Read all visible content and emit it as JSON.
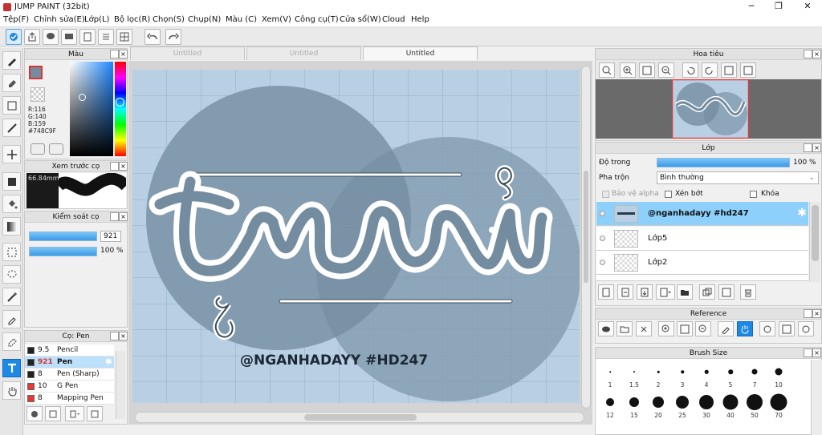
{
  "app": {
    "title": "JUMP PAINT (32bit)"
  },
  "window_controls": {
    "minimize": "─",
    "restore": "❐",
    "close": "✕"
  },
  "menu": [
    "Tệp(F)",
    "Chỉnh sửa(E)",
    "Lớp(L)",
    "Bộ lọc(R)",
    "Chọn(S)",
    "Chụp(N)",
    "Màu (C)",
    "Xem(V)",
    "Công cụ(T)",
    "Cửa sổ(W)",
    "Cloud",
    "Help"
  ],
  "tabs": [
    "Untitled",
    "Untitled",
    "Untitled"
  ],
  "color_panel": {
    "title": "Màu",
    "rgb": [
      "R:116",
      "G:140",
      "B:159"
    ],
    "hex": "#748C9F",
    "current_color": "#748C9F"
  },
  "brush_preview": {
    "title": "Xem trước cọ",
    "size": "66.84mm"
  },
  "brush_control": {
    "title": "Kiểm soát cọ",
    "size_value": "921",
    "opacity_value": "100 %"
  },
  "pen_panel": {
    "title": "Cọ: Pen",
    "items": [
      {
        "size": "9.5",
        "name": "Pencil",
        "color": "#222222"
      },
      {
        "size": "921",
        "name": "Pen",
        "color": "#222222"
      },
      {
        "size": "8",
        "name": "Pen (Sharp)",
        "color": "#222222"
      },
      {
        "size": "10",
        "name": "G Pen",
        "color": "#e53935"
      },
      {
        "size": "8",
        "name": "Mapping Pen",
        "color": "#e53935"
      }
    ]
  },
  "canvas": {
    "main_text": "treroi",
    "subtitle": "@NGANHADAYY #HD247",
    "bg_color": "#b8cfe4",
    "circle_color": "#748C9F"
  },
  "navigator": {
    "title": "Hoa tiêu"
  },
  "layers": {
    "title": "Lớp",
    "opacity_label": "Độ trong",
    "opacity_value": "100 %",
    "blend_label": "Pha trộn",
    "blend_value": "Bình thường",
    "protect_alpha": "Bảo vệ alpha",
    "clipping": "Xén bớt",
    "lock": "Khóa",
    "rows": [
      {
        "name": "@nganhadayy #hd247",
        "selected": true
      },
      {
        "name": "Lớp5",
        "selected": false
      },
      {
        "name": "Lớp2",
        "selected": false
      }
    ]
  },
  "reference": {
    "title": "Reference"
  },
  "brush_size": {
    "title": "Brush Size",
    "sizes_row1": [
      "1",
      "1.5",
      "2",
      "3",
      "4",
      "5",
      "7",
      "10"
    ],
    "sizes_row2": [
      "12",
      "15",
      "20",
      "25",
      "30",
      "40",
      "50",
      "70"
    ]
  }
}
